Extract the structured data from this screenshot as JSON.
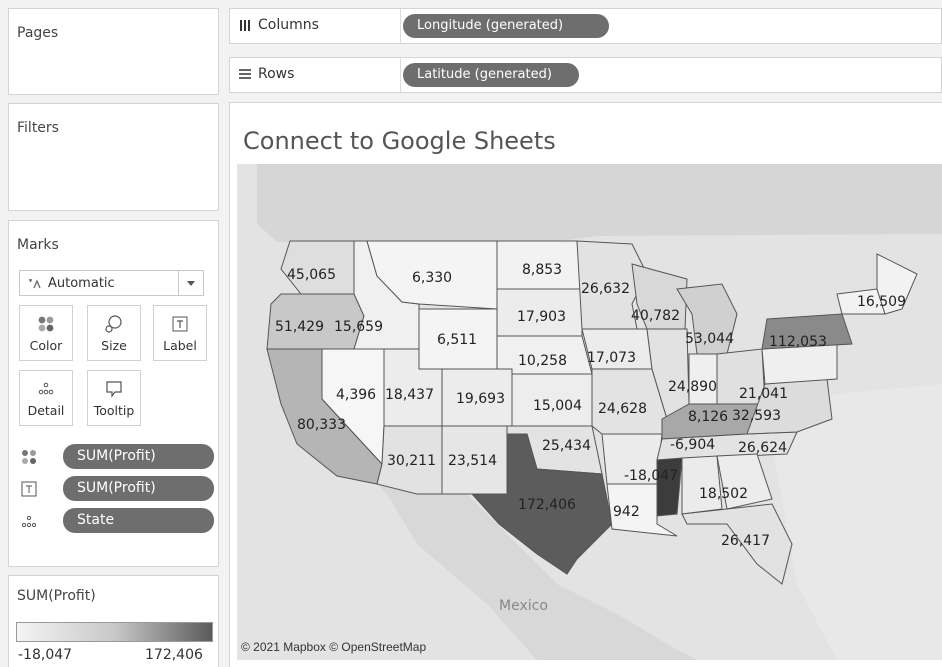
{
  "pages": {
    "title": "Pages"
  },
  "filters": {
    "title": "Filters"
  },
  "marks": {
    "title": "Marks",
    "mark_type": "Automatic",
    "buttons": {
      "color": "Color",
      "size": "Size",
      "label": "Label",
      "detail": "Detail",
      "tooltip": "Tooltip"
    },
    "pills": [
      "SUM(Profit)",
      "SUM(Profit)",
      "State"
    ]
  },
  "shelves": {
    "columns_label": "Columns",
    "columns_pill": "Longitude (generated)",
    "rows_label": "Rows",
    "rows_pill": "Latitude (generated)"
  },
  "view": {
    "title": "Connect to Google Sheets",
    "copyright": "© 2021 Mapbox © OpenStreetMap",
    "basemap_labels": {
      "mexico": "Mexico"
    }
  },
  "legend": {
    "title": "SUM(Profit)",
    "min": "-18,047",
    "max": "172,406"
  },
  "map_state_profits": [
    {
      "state": "Washington",
      "value": "45,065"
    },
    {
      "state": "Oregon",
      "value": "51,429"
    },
    {
      "state": "California",
      "value": "80,333"
    },
    {
      "state": "Idaho",
      "value": "15,659"
    },
    {
      "state": "Nevada",
      "value": "4,396"
    },
    {
      "state": "Montana",
      "value": "6,330"
    },
    {
      "state": "Wyoming",
      "value": "6,511"
    },
    {
      "state": "Utah",
      "value": "18,437"
    },
    {
      "state": "Arizona",
      "value": "30,211"
    },
    {
      "state": "Colorado",
      "value": "19,693"
    },
    {
      "state": "New Mexico",
      "value": "23,514"
    },
    {
      "state": "North Dakota",
      "value": "8,853"
    },
    {
      "state": "South Dakota",
      "value": "17,903"
    },
    {
      "state": "Nebraska",
      "value": "10,258"
    },
    {
      "state": "Kansas",
      "value": "15,004"
    },
    {
      "state": "Oklahoma",
      "value": "25,434"
    },
    {
      "state": "Texas",
      "value": "172,406"
    },
    {
      "state": "Minnesota",
      "value": "26,632"
    },
    {
      "state": "Iowa",
      "value": "17,073"
    },
    {
      "state": "Missouri",
      "value": "24,628"
    },
    {
      "state": "Louisiana",
      "value": "942"
    },
    {
      "state": "Wisconsin",
      "value": "40,782"
    },
    {
      "state": "Illinois",
      "value": "24,890"
    },
    {
      "state": "Michigan",
      "value": "53,044"
    },
    {
      "state": "Indiana",
      "value": "8,126"
    },
    {
      "state": "Ohio",
      "value": "21,041"
    },
    {
      "state": "Kentucky",
      "value": "-6,904"
    },
    {
      "state": "Tennessee",
      "value": "26,624"
    },
    {
      "state": "Mississippi",
      "value": "-18,047"
    },
    {
      "state": "Alabama",
      "value": "18,502"
    },
    {
      "state": "Florida",
      "value": "26,417"
    },
    {
      "state": "Virginia",
      "value": "32,593"
    },
    {
      "state": "New York",
      "value": "112,053"
    },
    {
      "state": "Vermont",
      "value": "16,509"
    }
  ]
}
